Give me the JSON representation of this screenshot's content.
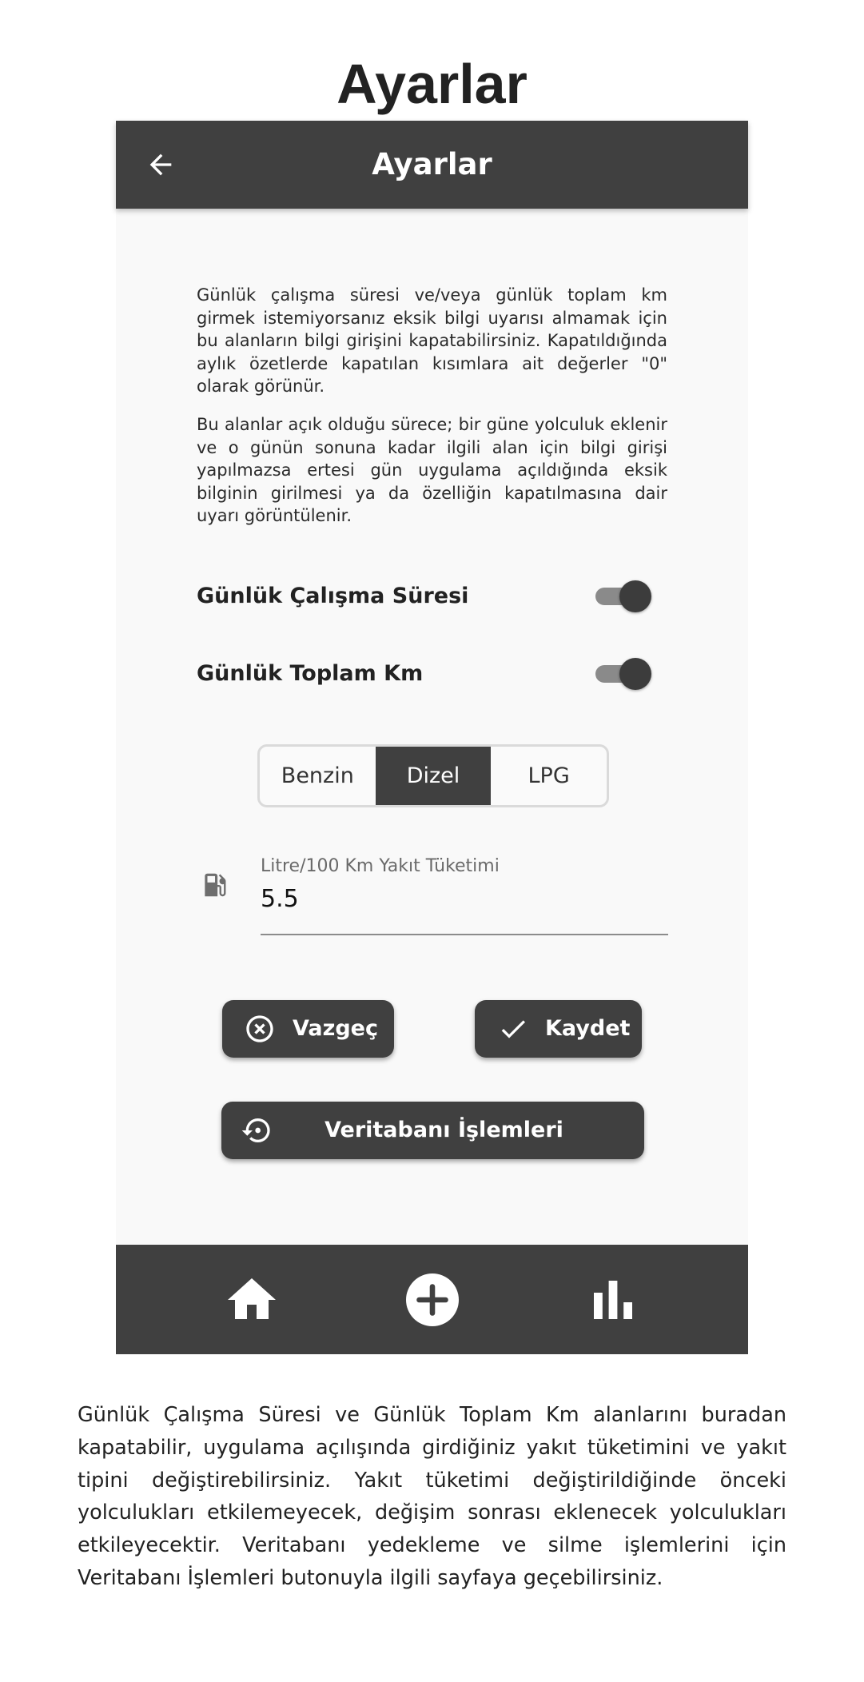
{
  "page": {
    "title": "Ayarlar",
    "description": "Günlük Çalışma Süresi ve Günlük Toplam Km alanlarını buradan kapatabilir, uygulama açılışında girdiğiniz yakıt tüketimini ve yakıt tipini değiştirebilirsiniz. Yakıt tüketimi değiştirildiğinde önceki yolculukları etkilemeyecek, değişim sonrası eklenecek yolculukları etkileyecektir. Veritabanı yedekleme ve silme işlemlerini için Veritabanı İşlemleri butonuyla ilgili sayfaya geçebilirsiniz."
  },
  "app_bar": {
    "title": "Ayarlar",
    "back_icon": "arrow-back-icon"
  },
  "info": {
    "paragraph_1": "Günlük çalışma süresi ve/veya günlük toplam km girmek istemiyorsanız eksik bilgi uyarısı almamak için bu alanların bilgi girişini kapatabilirsiniz. Kapatıldığında aylık özetlerde kapatılan kısımlara ait değerler \"0\" olarak görünür.",
    "paragraph_2": "Bu alanlar açık olduğu sürece; bir güne yolculuk eklenir ve o günün sonuna kadar ilgili alan için bilgi girişi yapılmazsa ertesi gün uygulama açıldığında eksik bilginin girilmesi ya da özelliğin kapatılmasına dair uyarı görüntülenir."
  },
  "toggles": [
    {
      "label": "Günlük Çalışma Süresi",
      "on": true
    },
    {
      "label": "Günlük Toplam Km",
      "on": true
    }
  ],
  "fuel_type": {
    "options": [
      "Benzin",
      "Dizel",
      "LPG"
    ],
    "selected": "Dizel"
  },
  "consumption": {
    "label": "Litre/100 Km Yakıt Tüketimi",
    "value": "5.5",
    "icon": "fuel-pump-icon"
  },
  "buttons": {
    "cancel": "Vazgeç",
    "save": "Kaydet",
    "database": "Veritabanı İşlemleri"
  },
  "bottom_nav": {
    "items": [
      "home-icon",
      "add-circle-icon",
      "bar-chart-icon"
    ]
  },
  "colors": {
    "primary": "#404040",
    "surface": "#f9f9f9",
    "on_primary": "#ffffff"
  }
}
